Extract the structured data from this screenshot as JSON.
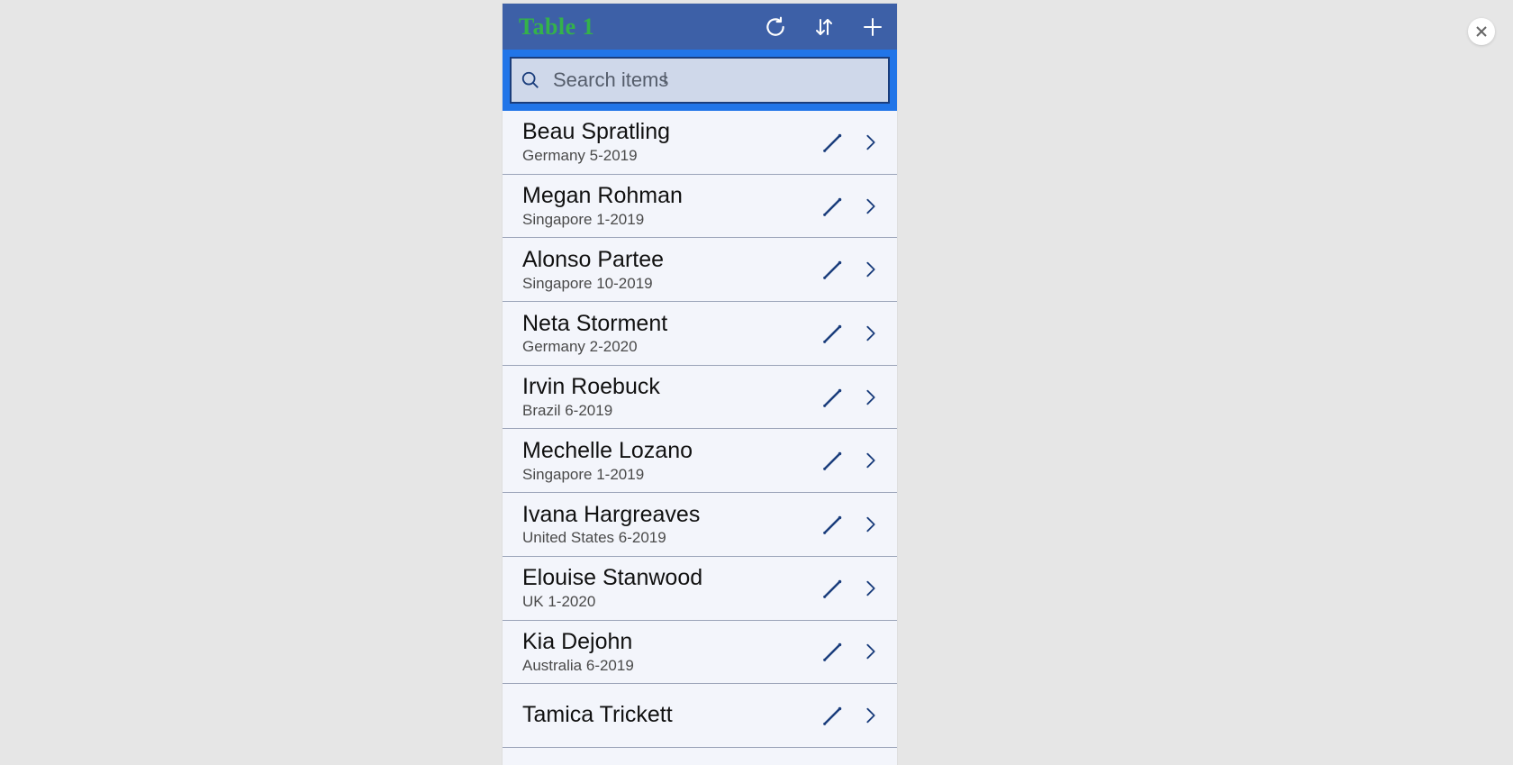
{
  "header": {
    "title": "Table 1"
  },
  "search": {
    "placeholder": "Search items",
    "value": ""
  },
  "items": [
    {
      "name": "Beau Spratling",
      "sub": "Germany 5-2019"
    },
    {
      "name": "Megan Rohman",
      "sub": "Singapore 1-2019"
    },
    {
      "name": "Alonso Partee",
      "sub": "Singapore 10-2019"
    },
    {
      "name": "Neta Storment",
      "sub": "Germany 2-2020"
    },
    {
      "name": "Irvin Roebuck",
      "sub": "Brazil 6-2019"
    },
    {
      "name": "Mechelle Lozano",
      "sub": "Singapore 1-2019"
    },
    {
      "name": "Ivana Hargreaves",
      "sub": "United States 6-2019"
    },
    {
      "name": "Elouise Stanwood",
      "sub": "UK 1-2020"
    },
    {
      "name": "Kia Dejohn",
      "sub": "Australia 6-2019"
    },
    {
      "name": "Tamica Trickett",
      "sub": ""
    }
  ]
}
